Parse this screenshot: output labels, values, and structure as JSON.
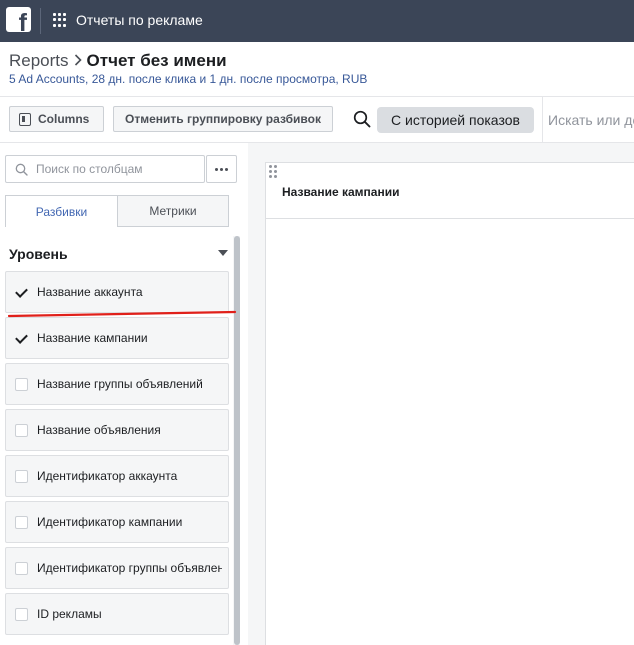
{
  "topbar": {
    "logo": "f",
    "app_title": "Отчеты по рекламе"
  },
  "header": {
    "breadcrumb_root": "Reports",
    "breadcrumb_current": "Отчет без имени",
    "subtitle": "5 Ad Accounts, 28 дн. после клика и 1 дн. после просмотра, RUB"
  },
  "toolbar": {
    "columns_label": "Columns",
    "ungroup_label": "Отменить группировку разбивок",
    "history_label": "С историей показов",
    "search_placeholder": "Искать или до"
  },
  "left_panel": {
    "search_placeholder": "Поиск по столбцам",
    "tabs": [
      {
        "label": "Разбивки",
        "active": true
      },
      {
        "label": "Метрики",
        "active": false
      }
    ],
    "section_title": "Уровень",
    "items": [
      {
        "label": "Название аккаунта",
        "checked": true
      },
      {
        "label": "Название кампании",
        "checked": true
      },
      {
        "label": "Название группы объявлений",
        "checked": false
      },
      {
        "label": "Название объявления",
        "checked": false
      },
      {
        "label": "Идентификатор аккаунта",
        "checked": false
      },
      {
        "label": "Идентификатор кампании",
        "checked": false
      },
      {
        "label": "Идентификатор группы объявлений",
        "checked": false
      },
      {
        "label": "ID рекламы",
        "checked": false
      }
    ]
  },
  "table": {
    "columns": [
      "Название кампании"
    ]
  },
  "colors": {
    "topbar": "#3b4557",
    "link": "#385898",
    "active_tab": "#4267b2",
    "annotation": "#e0201a"
  }
}
